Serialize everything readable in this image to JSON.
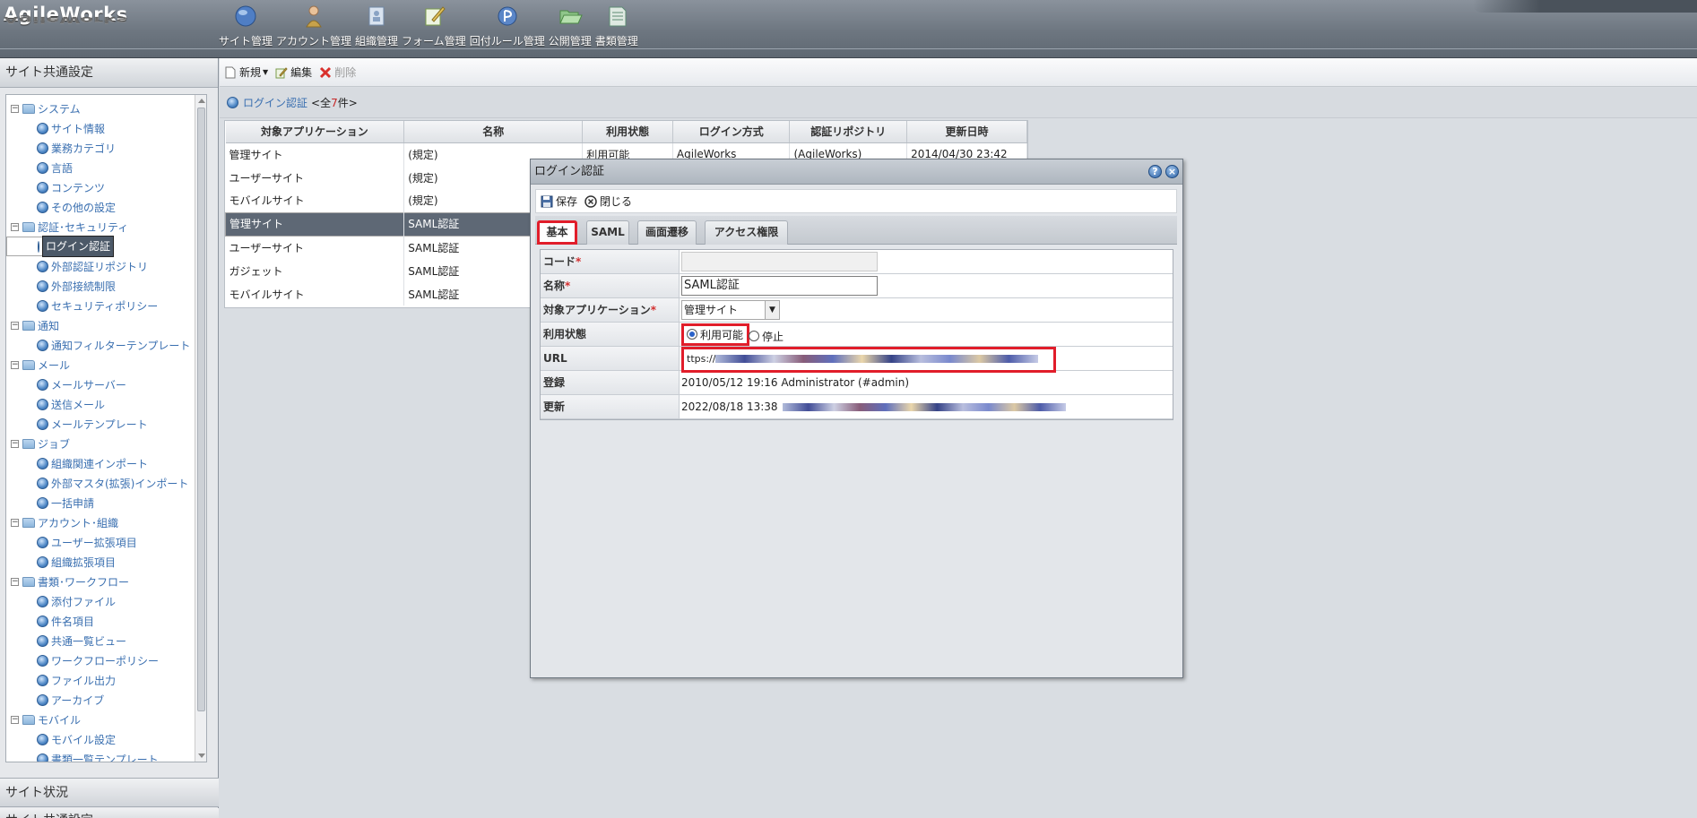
{
  "header": {
    "logo": "AgileWorks",
    "nav": [
      {
        "label": "サイト管理",
        "icon": "globe-icon"
      },
      {
        "label": "アカウント管理",
        "icon": "person-icon"
      },
      {
        "label": "組織管理",
        "icon": "organization-icon"
      },
      {
        "label": "フォーム管理",
        "icon": "form-edit-icon"
      },
      {
        "label": "回付ルール管理",
        "icon": "route-rule-icon"
      },
      {
        "label": "公開管理",
        "icon": "open-folder-icon"
      },
      {
        "label": "書類管理",
        "icon": "document-icon"
      }
    ]
  },
  "sidebar": {
    "title": "サイト共通設定",
    "tree": [
      {
        "label": "システム",
        "type": "category"
      },
      {
        "label": "サイト情報",
        "type": "item"
      },
      {
        "label": "業務カテゴリ",
        "type": "item"
      },
      {
        "label": "言語",
        "type": "item"
      },
      {
        "label": "コンテンツ",
        "type": "item"
      },
      {
        "label": "その他の設定",
        "type": "item"
      },
      {
        "label": "認証･セキュリティ",
        "type": "category"
      },
      {
        "label": "ログイン認証",
        "type": "item",
        "selected": true
      },
      {
        "label": "外部認証リポジトリ",
        "type": "item"
      },
      {
        "label": "外部接続制限",
        "type": "item"
      },
      {
        "label": "セキュリティポリシー",
        "type": "item"
      },
      {
        "label": "通知",
        "type": "category"
      },
      {
        "label": "通知フィルターテンプレート",
        "type": "item"
      },
      {
        "label": "メール",
        "type": "category"
      },
      {
        "label": "メールサーバー",
        "type": "item"
      },
      {
        "label": "送信メール",
        "type": "item"
      },
      {
        "label": "メールテンプレート",
        "type": "item"
      },
      {
        "label": "ジョブ",
        "type": "category"
      },
      {
        "label": "組織関連インポート",
        "type": "item"
      },
      {
        "label": "外部マスタ(拡張)インポート",
        "type": "item"
      },
      {
        "label": "一括申請",
        "type": "item"
      },
      {
        "label": "アカウント･組織",
        "type": "category"
      },
      {
        "label": "ユーザー拡張項目",
        "type": "item"
      },
      {
        "label": "組織拡張項目",
        "type": "item"
      },
      {
        "label": "書類･ワークフロー",
        "type": "category"
      },
      {
        "label": "添付ファイル",
        "type": "item"
      },
      {
        "label": "件名項目",
        "type": "item"
      },
      {
        "label": "共通一覧ビュー",
        "type": "item"
      },
      {
        "label": "ワークフローポリシー",
        "type": "item"
      },
      {
        "label": "ファイル出力",
        "type": "item"
      },
      {
        "label": "アーカイブ",
        "type": "item"
      },
      {
        "label": "モバイル",
        "type": "category"
      },
      {
        "label": "モバイル設定",
        "type": "item"
      },
      {
        "label": "書類一覧テンプレート",
        "type": "item"
      }
    ],
    "footer1": "サイト状況",
    "footer2": "サイト共通設定"
  },
  "toolbar": {
    "new_label": "新規",
    "edit_label": "編集",
    "delete_label": "削除"
  },
  "list": {
    "title": "ログイン認証",
    "count_prefix": "<全",
    "count": "7",
    "count_suffix": "件>",
    "columns": [
      "対象アプリケーション",
      "名称",
      "利用状態",
      "ログイン方式",
      "認証リポジトリ",
      "更新日時"
    ],
    "rows": [
      {
        "app": "管理サイト",
        "name": "(規定)",
        "status": "利用可能",
        "method": "AgileWorks",
        "repo": "(AgileWorks)",
        "updated": "2014/04/30 23:42"
      },
      {
        "app": "ユーザーサイト",
        "name": "(規定)",
        "status": "",
        "method": "",
        "repo": "",
        "updated": ""
      },
      {
        "app": "モバイルサイト",
        "name": "(規定)",
        "status": "",
        "method": "",
        "repo": "",
        "updated": ""
      },
      {
        "app": "管理サイト",
        "name": "SAML認証",
        "status": "",
        "method": "",
        "repo": "",
        "updated": "",
        "selected": true
      },
      {
        "app": "ユーザーサイト",
        "name": "SAML認証",
        "status": "",
        "method": "",
        "repo": "",
        "updated": ""
      },
      {
        "app": "ガジェット",
        "name": "SAML認証",
        "status": "",
        "method": "",
        "repo": "",
        "updated": ""
      },
      {
        "app": "モバイルサイト",
        "name": "SAML認証",
        "status": "",
        "method": "",
        "repo": "",
        "updated": ""
      }
    ]
  },
  "dialog": {
    "title": "ログイン認証",
    "save_label": "保存",
    "close_label": "閉じる",
    "tabs": [
      "基本",
      "SAML",
      "画面遷移",
      "アクセス権限"
    ],
    "active_tab": "基本",
    "fields": {
      "code_label": "コード",
      "code_value": "",
      "name_label": "名称",
      "name_value": "SAML認証",
      "app_label": "対象アプリケーション",
      "app_value": "管理サイト",
      "status_label": "利用状態",
      "status_option_available": "利用可能",
      "status_option_stopped": "停止",
      "status_selected": "利用可能",
      "url_label": "URL",
      "url_prefix": "ttps://",
      "registered_label": "登録",
      "registered_value": "2010/05/12 19:16  Administrator (#admin)",
      "updated_label": "更新",
      "updated_value": "2022/08/18 13:38"
    }
  },
  "colors": {
    "highlight": "#e11d2a",
    "link": "#3a6fb0",
    "selected_row": "#5e6875"
  }
}
